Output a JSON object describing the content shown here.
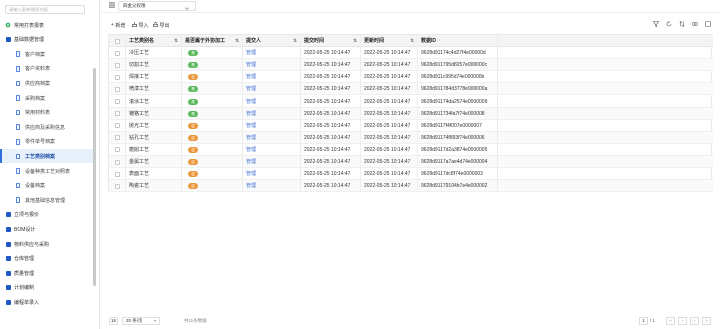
{
  "sidebar": {
    "search_placeholder": "请输入菜单/搜索内容",
    "items": [
      {
        "label": "常用打表报表",
        "level": "top",
        "icon": "settings-icon"
      },
      {
        "label": "基础数据管理",
        "level": "top",
        "icon": "folder-icon"
      },
      {
        "label": "客户档案",
        "level": "sub",
        "icon": "doc-icon"
      },
      {
        "label": "客户资料表",
        "level": "sub",
        "icon": "doc-icon"
      },
      {
        "label": "供应商档案",
        "level": "sub",
        "icon": "doc-icon"
      },
      {
        "label": "采购档案",
        "level": "sub",
        "icon": "doc-icon"
      },
      {
        "label": "常用材料表",
        "level": "sub",
        "icon": "doc-icon"
      },
      {
        "label": "供应商及采购信息",
        "level": "sub",
        "icon": "doc-icon"
      },
      {
        "label": "零件单号档案",
        "level": "sub",
        "icon": "doc-icon"
      },
      {
        "label": "工艺类别档案",
        "level": "sub",
        "icon": "doc-icon",
        "active": true
      },
      {
        "label": "设备种类工艺对照表",
        "level": "sub",
        "icon": "doc-icon"
      },
      {
        "label": "设备档案",
        "level": "sub",
        "icon": "doc-icon"
      },
      {
        "label": "其他基础信息管理",
        "level": "sub",
        "icon": "doc-icon"
      },
      {
        "label": "立项与报价",
        "level": "top",
        "icon": "folder-icon"
      },
      {
        "label": "BOM设计",
        "level": "top",
        "icon": "folder-icon"
      },
      {
        "label": "物料供应与采购",
        "level": "top",
        "icon": "folder-icon"
      },
      {
        "label": "仓库管理",
        "level": "top",
        "icon": "folder-icon"
      },
      {
        "label": "质量管理",
        "level": "top",
        "icon": "folder-icon"
      },
      {
        "label": "计划编制",
        "level": "top",
        "icon": "folder-icon"
      },
      {
        "label": "编程单录入",
        "level": "top",
        "icon": "folder-icon"
      }
    ]
  },
  "topbar": {
    "select_value": "四金父权限",
    "menu_icon": "hamburger-icon"
  },
  "toolbar": {
    "new_label": "新增",
    "import_label": "导入",
    "export_label": "导出",
    "right_icons": [
      "filter-icon",
      "refresh-icon",
      "sort-icon",
      "view-icon",
      "window-icon"
    ]
  },
  "table": {
    "columns": [
      "",
      "工艺类别名",
      "是否属于外协加工",
      "提交人",
      "提交时间",
      "更新时间",
      "数据ID"
    ],
    "rows": [
      {
        "name": "冷压工艺",
        "flag": "是",
        "flag_color": "green",
        "user": "管理",
        "submit": "2022-05-25 10:14:47",
        "update": "2022-05-25 10:14:47",
        "id": "9628d91174c4d27f4e00000d"
      },
      {
        "name": "切割工艺",
        "flag": "是",
        "flag_color": "green",
        "user": "管理",
        "submit": "2022-05-25 10:14:47",
        "update": "2022-05-25 10:14:47",
        "id": "9628d911795d8257e000000c"
      },
      {
        "name": "焊接工艺",
        "flag": "否",
        "flag_color": "orange",
        "user": "管理",
        "submit": "2022-05-25 10:14:47",
        "update": "2022-05-25 10:14:47",
        "id": "9628d911c995d74e000000b"
      },
      {
        "name": "喷漆工艺",
        "flag": "是",
        "flag_color": "green",
        "user": "管理",
        "submit": "2022-05-25 10:14:47",
        "update": "2022-05-25 10:14:47",
        "id": "9628d911784d3778e000000a"
      },
      {
        "name": "滚涂工艺",
        "flag": "是",
        "flag_color": "green",
        "user": "管理",
        "submit": "2022-05-25 10:14:47",
        "update": "2022-05-25 10:14:47",
        "id": "9628d91174da2574e0000009"
      },
      {
        "name": "镀铬工艺",
        "flag": "是",
        "flag_color": "green",
        "user": "管理",
        "submit": "2022-05-25 10:14:47",
        "update": "2022-05-25 10:14:47",
        "id": "9628d911734fa7f74e000008"
      },
      {
        "name": "抛光工艺",
        "flag": "否",
        "flag_color": "orange",
        "user": "管理",
        "submit": "2022-05-25 10:14:47",
        "update": "2022-05-25 10:14:47",
        "id": "9628d9117f4f007e0000007"
      },
      {
        "name": "钻孔工艺",
        "flag": "否",
        "flag_color": "orange",
        "user": "管理",
        "submit": "2022-05-25 10:14:47",
        "update": "2022-05-25 10:14:47",
        "id": "9628d91174f893f74e000006"
      },
      {
        "name": "磨削工艺",
        "flag": "否",
        "flag_color": "orange",
        "user": "管理",
        "submit": "2022-05-25 10:14:47",
        "update": "2022-05-25 10:14:47",
        "id": "9628d9117d2a3874e0000005"
      },
      {
        "name": "金属工艺",
        "flag": "否",
        "flag_color": "orange",
        "user": "管理",
        "submit": "2022-05-25 10:14:47",
        "update": "2022-05-25 10:14:47",
        "id": "9628d9117a7ae4d74e000004"
      },
      {
        "name": "表面工艺",
        "flag": "否",
        "flag_color": "orange",
        "user": "管理",
        "submit": "2022-05-25 10:14:47",
        "update": "2022-05-25 10:14:47",
        "id": "9628d9117dc8f74e0000003"
      },
      {
        "name": "陶瓷工艺",
        "flag": "否",
        "flag_color": "orange",
        "user": "管理",
        "submit": "2022-05-25 10:14:47",
        "update": "2022-05-25 10:14:47",
        "id": "9628d91179104b7e4e000002"
      }
    ]
  },
  "footer": {
    "total_count": "16",
    "page_size": "20 条/页",
    "info": "共11条数据",
    "current_page": "1",
    "page_total": "/ 1"
  },
  "colors": {
    "accent": "#2f6fe0",
    "tag_green": "#5cb85c",
    "tag_orange": "#e8993c",
    "link": "#3c6fd6"
  }
}
